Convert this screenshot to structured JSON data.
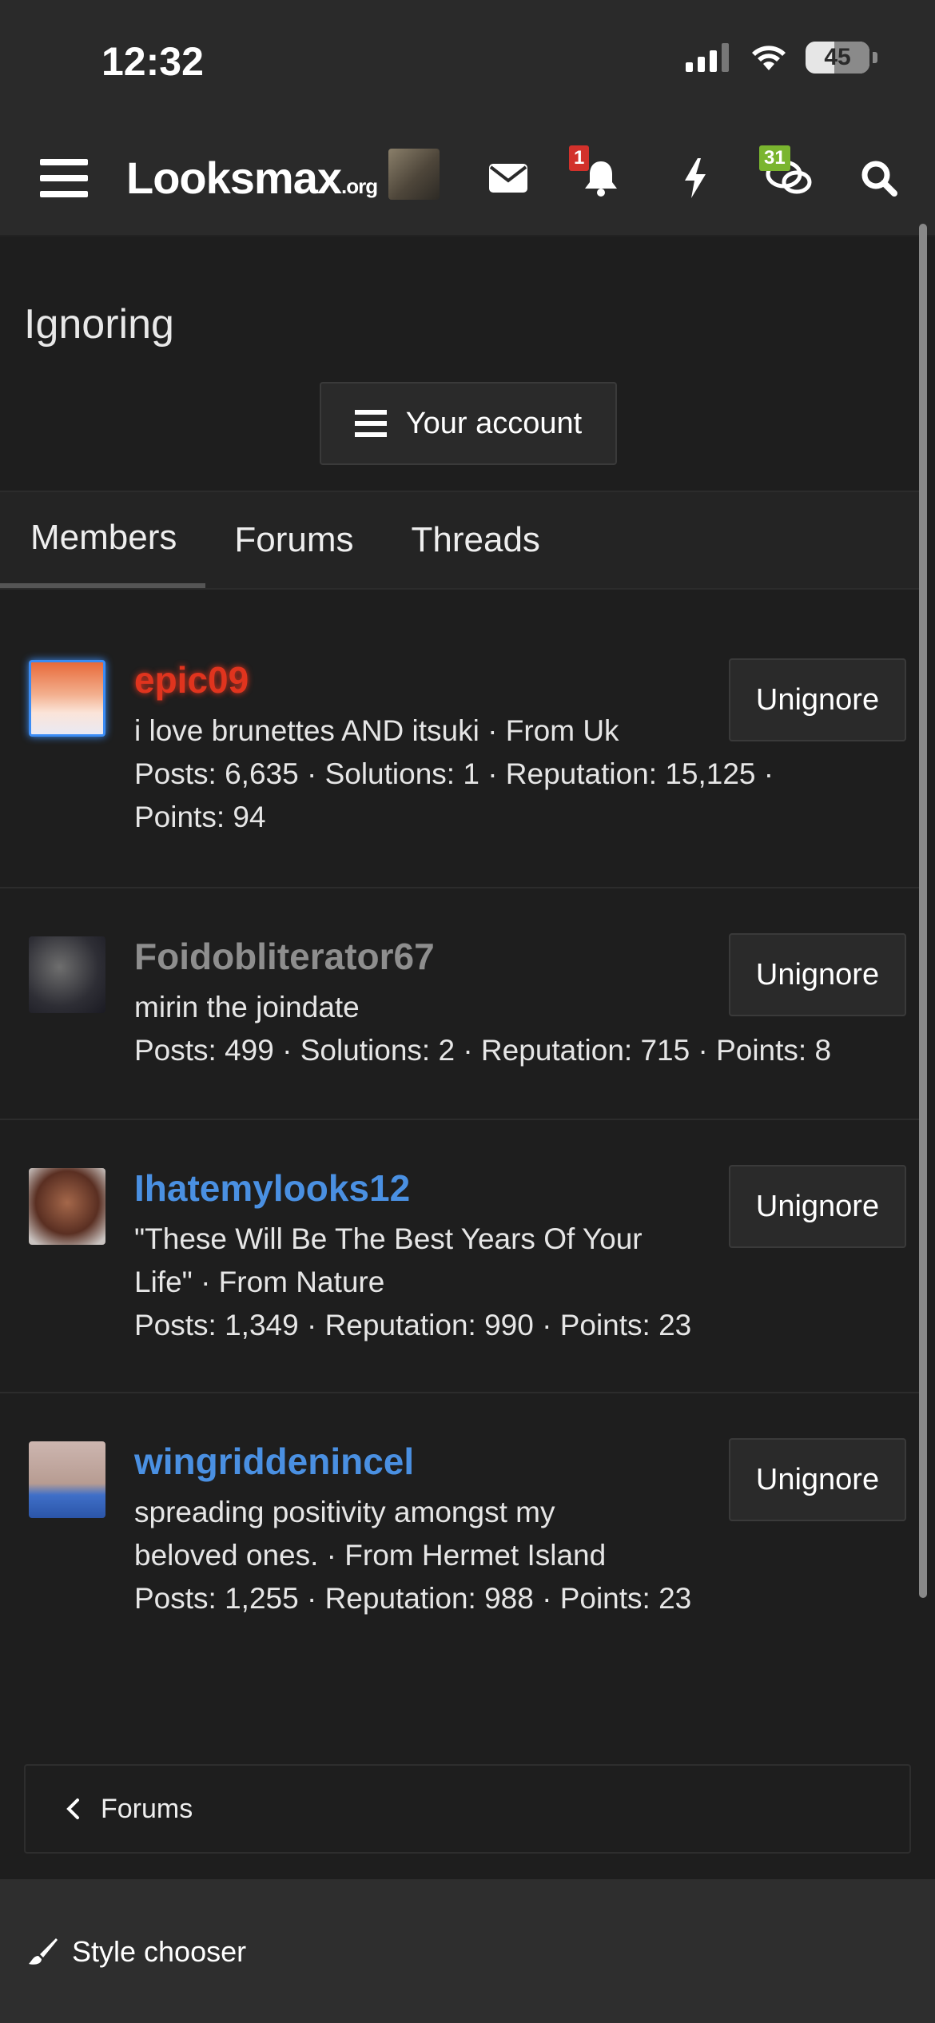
{
  "status_bar": {
    "time": "12:32",
    "battery": "45"
  },
  "nav": {
    "logo_main": "Looksmax",
    "logo_suffix": ".org",
    "alerts_count": "1",
    "conversations_count": "31"
  },
  "page": {
    "title": "Ignoring",
    "account_button": "Your account"
  },
  "tabs": [
    {
      "label": "Members"
    },
    {
      "label": "Forums"
    },
    {
      "label": "Threads"
    }
  ],
  "members": [
    {
      "name": "epic09",
      "name_color": "#e0341e",
      "line1": "i love brunettes AND itsuki · From Uk",
      "line2": "Posts: 6,635 · Solutions: 1 · Reputation: 15,125 ·",
      "line3": "Points: 94",
      "button": "Unignore"
    },
    {
      "name": "Foidobliterator67",
      "name_color": "#8e8e8e",
      "line1": "mirin the joindate",
      "line2": "Posts: 499 · Solutions: 2 · Reputation: 715 · Points: 8",
      "button": "Unignore"
    },
    {
      "name": "Ihatemylooks12",
      "name_color": "#4a90e2",
      "line1": "\"These Will Be The Best Years Of Your",
      "line2": "Life\" · From Nature",
      "line3": "Posts: 1,349 · Reputation: 990 · Points: 23",
      "button": "Unignore"
    },
    {
      "name": "wingriddenincel",
      "name_color": "#4a90e2",
      "line1": "spreading positivity amongst my",
      "line2": "beloved ones. · From Hermet Island",
      "line3": "Posts: 1,255 · Reputation: 988 · Points: 23",
      "button": "Unignore"
    }
  ],
  "breadcrumb": {
    "label": "Forums"
  },
  "footer": {
    "style_chooser": "Style chooser"
  }
}
